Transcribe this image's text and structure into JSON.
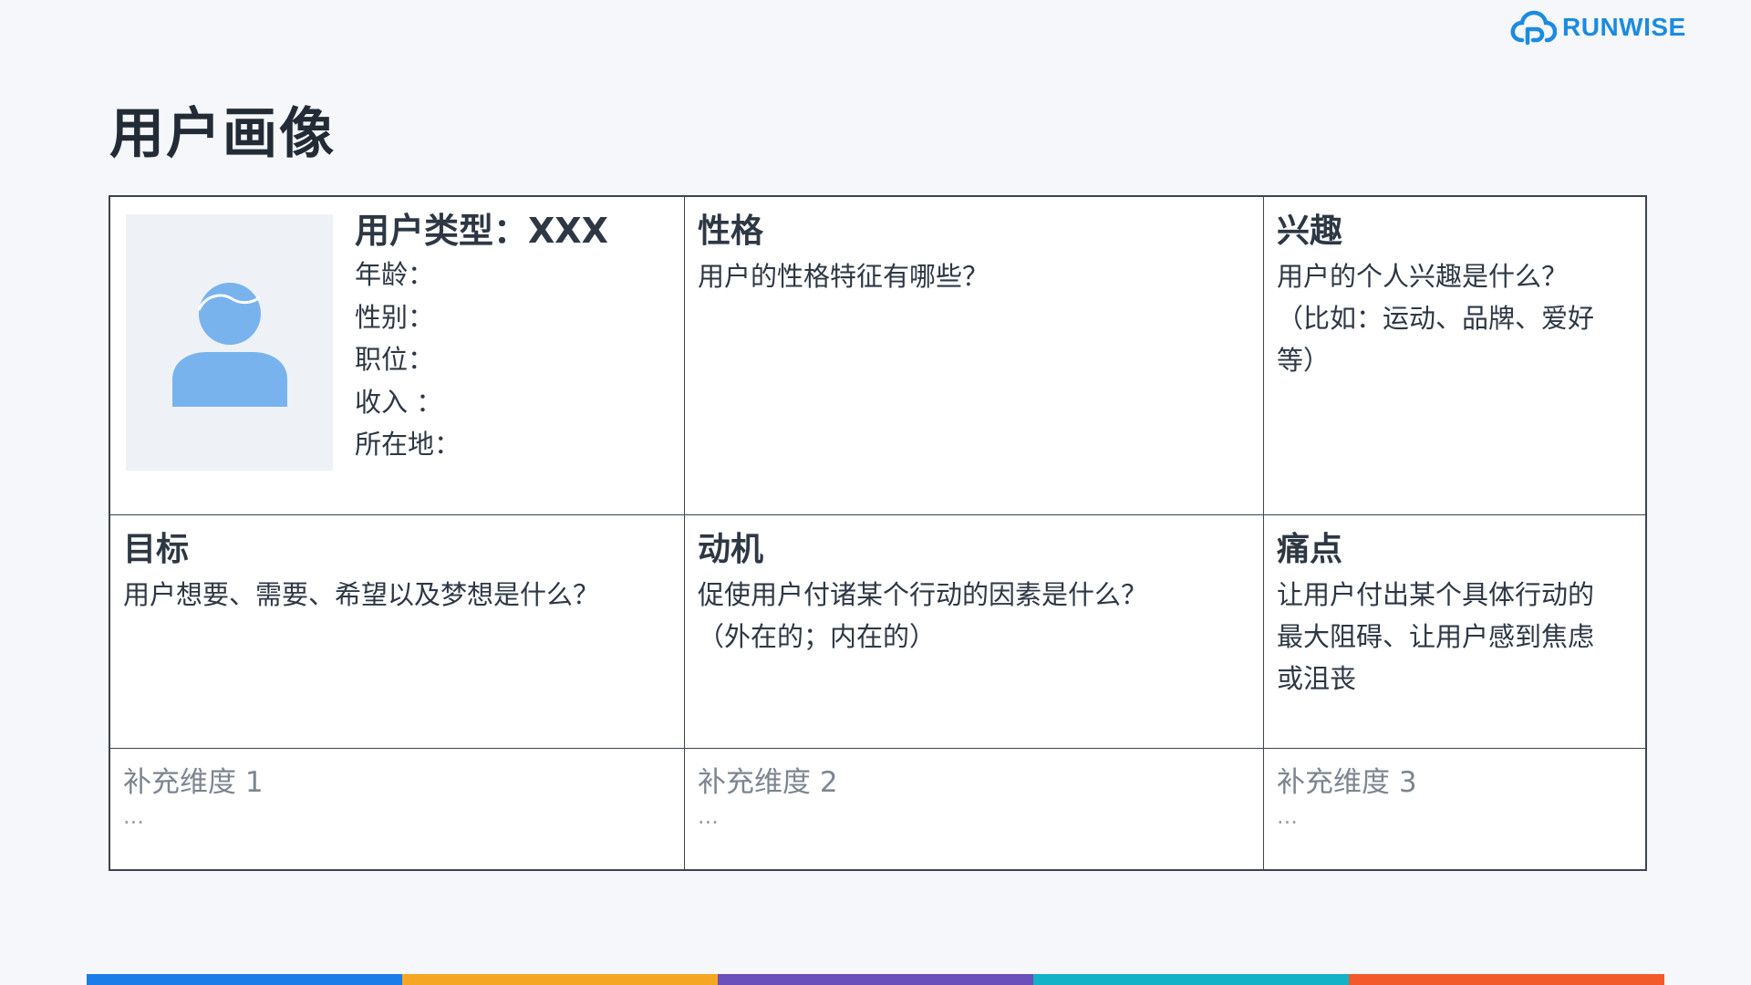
{
  "logo": {
    "text": "RUNWISE",
    "color": "#1c8be0"
  },
  "page_title": "用户画像",
  "profile": {
    "type_label": "用户类型：XXX",
    "fields": [
      "年龄：",
      "性别：",
      "职位：",
      "收入 ：",
      "所在地："
    ],
    "avatar_icon": "user-avatar-icon",
    "avatar_color": "#78b3ee"
  },
  "cells": {
    "personality": {
      "title": "性格",
      "text": "用户的性格特征有哪些？"
    },
    "interests": {
      "title": "兴趣",
      "text": "用户的个人兴趣是什么？\n（比如：运动、品牌、爱好\n等）"
    },
    "goals": {
      "title": "目标",
      "text": "用户想要、需要、希望以及梦想是什么？"
    },
    "motivation": {
      "title": "动机",
      "text": "促使用户付诸某个行动的因素是什么？\n（外在的；内在的）"
    },
    "pain_points": {
      "title": "痛点",
      "text": "让用户付出某个具体行动的\n最大阻碍、让用户感到焦虑\n或沮丧"
    }
  },
  "supplementary": [
    {
      "title": "补充维度 1",
      "text": "..."
    },
    {
      "title": "补充维度 2",
      "text": "..."
    },
    {
      "title": "补充维度 3",
      "text": "..."
    }
  ],
  "bottom_bar_colors": [
    "#1a7de8",
    "#f5a623",
    "#6b4fbb",
    "#14b2c6",
    "#f25a2c"
  ]
}
